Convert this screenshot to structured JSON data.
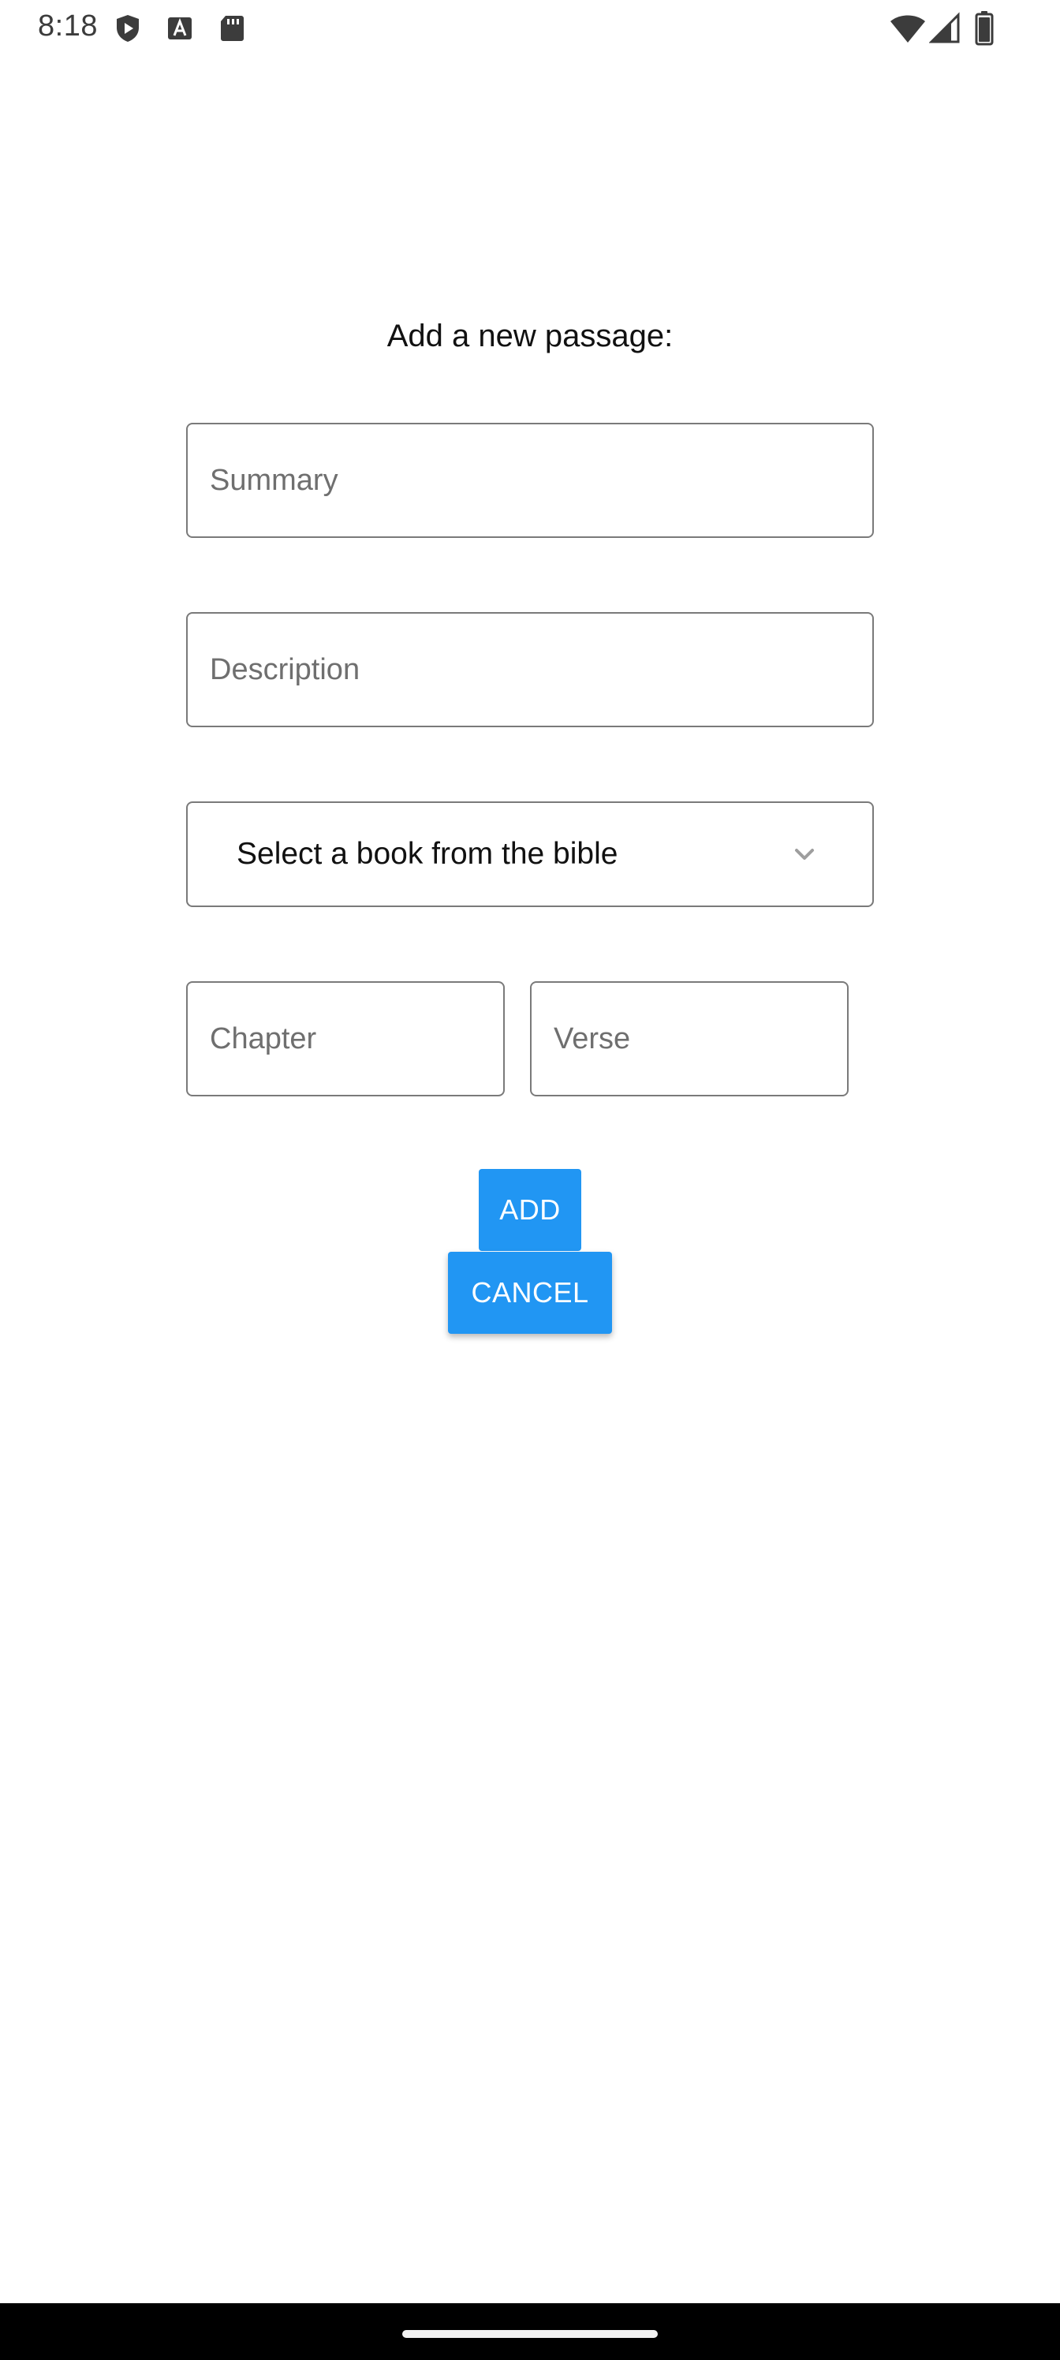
{
  "status_bar": {
    "time": "8:18",
    "left_icons": [
      "shield-play-icon",
      "keyboard-a-icon",
      "sd-card-icon"
    ],
    "right_icons": [
      "wifi-icon",
      "cell-signal-icon",
      "battery-icon"
    ]
  },
  "form": {
    "title": "Add a new passage:",
    "summary_placeholder": "Summary",
    "description_placeholder": "Description",
    "book_select_label": "Select a book from the bible",
    "chapter_placeholder": "Chapter",
    "verse_placeholder": "Verse"
  },
  "actions": {
    "add_label": "ADD",
    "cancel_label": "CANCEL"
  },
  "colors": {
    "accent": "#2196f3",
    "field_border": "#7a7a7a",
    "placeholder": "#6f6f6f",
    "nav_bar": "#000000"
  }
}
